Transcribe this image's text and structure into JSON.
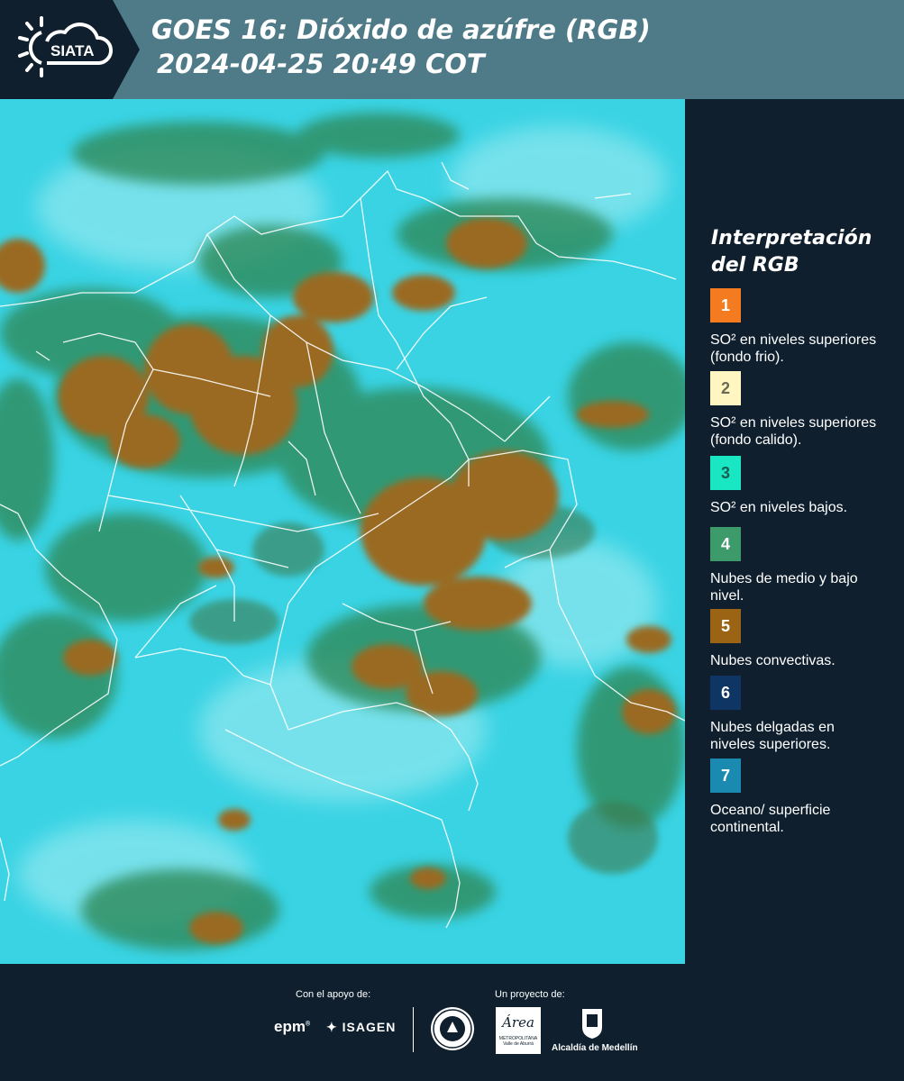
{
  "header": {
    "logo_text": "SIATA",
    "title_line1": "GOES 16: Dióxido de azúfre (RGB)",
    "title_line2": "2024-04-25 20:49 COT"
  },
  "legend": {
    "title_line1": "Interpretación",
    "title_line2": "del RGB",
    "items": [
      {
        "number": "1",
        "color": "#f47b20",
        "text_color": "#ffffff",
        "label": "SO² en niveles superiores (fondo frio)."
      },
      {
        "number": "2",
        "color": "#fff6c2",
        "text_color": "#6b6a55",
        "label": "SO² en niveles superiores (fondo calido)."
      },
      {
        "number": "3",
        "color": "#19e6c2",
        "text_color": "#1a5e52",
        "label": "SO² en niveles bajos."
      },
      {
        "number": "4",
        "color": "#3c9a6b",
        "text_color": "#ffffff",
        "label": "Nubes de medio y bajo nivel."
      },
      {
        "number": "5",
        "color": "#9a6414",
        "text_color": "#ffffff",
        "label": "Nubes convectivas."
      },
      {
        "number": "6",
        "color": "#0f3564",
        "text_color": "#ffffff",
        "label": "Nubes delgadas en niveles superiores."
      },
      {
        "number": "7",
        "color": "#1a8ab0",
        "text_color": "#ffffff",
        "label": "Oceano/ superficie continental."
      }
    ]
  },
  "footer": {
    "support_label": "Con el apoyo de:",
    "project_label": "Un proyecto de:",
    "sponsor1": "epm",
    "sponsor2": "ISAGEN",
    "partner_area_name": "Área",
    "partner_area_sub1": "METROPOLITANA",
    "partner_area_sub2": "Valle de Aburrá",
    "partner_alcaldia": "Alcaldía de Medellín"
  },
  "colors": {
    "header_bg": "#4f7a87",
    "dark_bg": "#0f1f2d",
    "map_ocean": "#3ad6e6",
    "cloud_convective": "#9a6a22",
    "cloud_low": "#2f8a5a"
  }
}
